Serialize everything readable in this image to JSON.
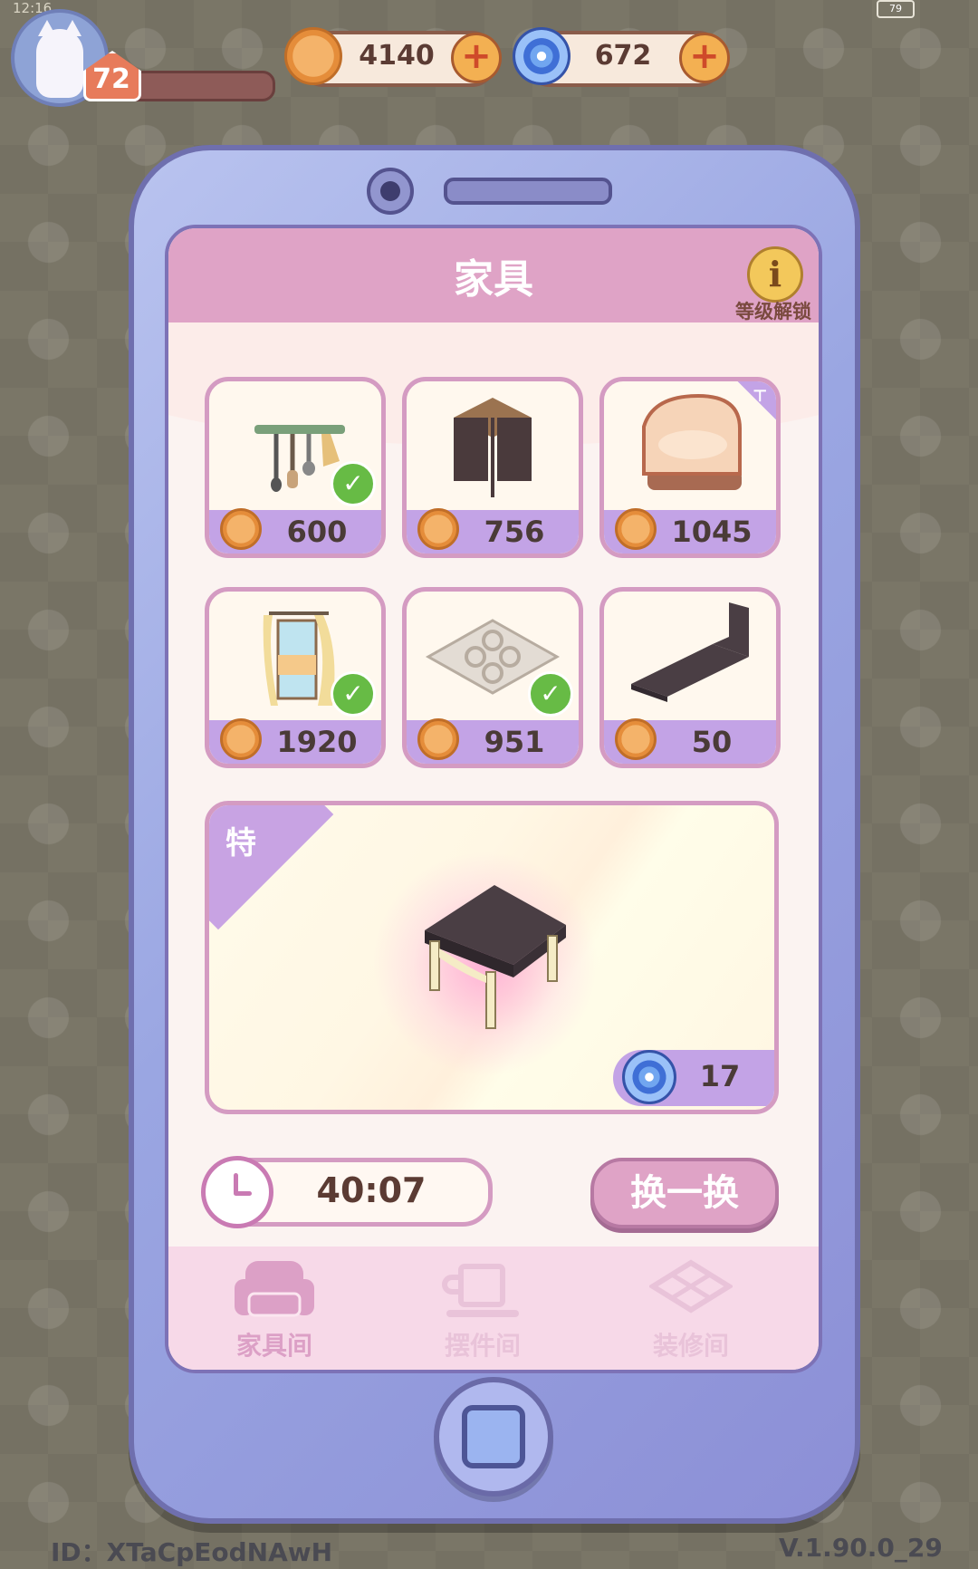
{
  "status_bar": {
    "time": "12:16",
    "battery": "79"
  },
  "player": {
    "level": "72"
  },
  "currencies": {
    "coins": {
      "value": "4140",
      "icon": "coin-icon",
      "add_label": "+"
    },
    "gems": {
      "value": "672",
      "icon": "swirl-gem-icon",
      "add_label": "+"
    }
  },
  "shop": {
    "title": "家具",
    "info_label": "等级解锁",
    "items": [
      {
        "name": "kitchen-utensil-rack",
        "price": "600",
        "owned": true
      },
      {
        "name": "folding-screen",
        "price": "756",
        "owned": false
      },
      {
        "name": "armchair",
        "price": "1045",
        "owned": false,
        "tag": true
      },
      {
        "name": "window-curtain",
        "price": "1920",
        "owned": true
      },
      {
        "name": "patterned-rug",
        "price": "951",
        "owned": true
      },
      {
        "name": "low-bed",
        "price": "50",
        "owned": false
      }
    ],
    "special": {
      "tag": "特",
      "item": "square-side-table",
      "price": "17"
    },
    "timer": "40:07",
    "swap_label": "换一换",
    "tabs": [
      {
        "label": "家具间",
        "icon": "sofa-icon",
        "active": true
      },
      {
        "label": "摆件间",
        "icon": "cup-icon",
        "active": false
      },
      {
        "label": "装修间",
        "icon": "floor-tile-icon",
        "active": false
      }
    ]
  },
  "footer": {
    "id": "ID：XTaCpEodNAwH",
    "version": "V.1.90.0_29"
  },
  "colors": {
    "tab_active": "#dca0c6",
    "tab_inactive": "#e9c3d9",
    "accent_pink": "#dfa3c6",
    "price_bar": "#c3a3e6"
  }
}
